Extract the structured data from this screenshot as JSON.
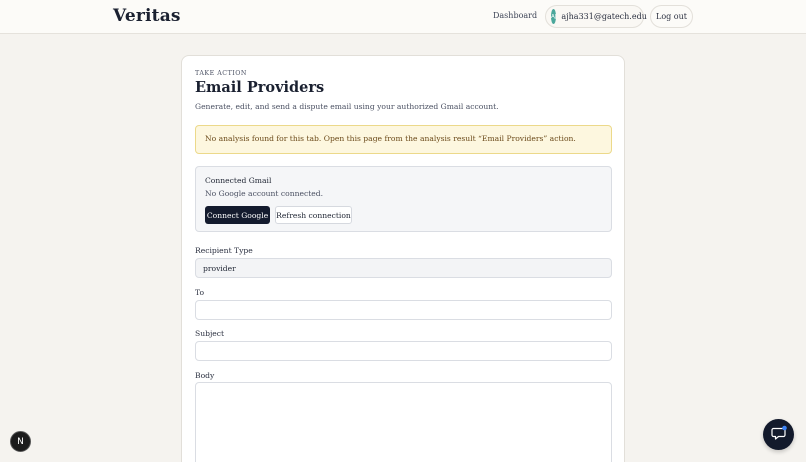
{
  "header": {
    "brand": "Veritas",
    "nav_dashboard": "Dashboard",
    "user_initials": "AJ",
    "user_email": "ajha331@gatech.edu",
    "logout_label": "Log out"
  },
  "page": {
    "eyebrow": "TAKE ACTION",
    "title": "Email Providers",
    "description": "Generate, edit, and send a dispute email using your authorized Gmail account.",
    "alert": "No analysis found for this tab. Open this page from the analysis result “Email Providers” action."
  },
  "gmail": {
    "title": "Connected Gmail",
    "status": "No Google account connected.",
    "connect_label": "Connect Google",
    "refresh_label": "Refresh connection"
  },
  "form": {
    "recipient_type_label": "Recipient Type",
    "recipient_type_value": "provider",
    "to_label": "To",
    "to_value": "",
    "subject_label": "Subject",
    "subject_value": "",
    "body_label": "Body",
    "body_value": ""
  },
  "widgets": {
    "left_badge": "N",
    "chat_icon": "chat-icon"
  },
  "colors": {
    "accent": "#141b2e",
    "avatar": "#4aa79b",
    "alert_bg": "#fdf7df",
    "chat_dot": "#3b82f6"
  }
}
